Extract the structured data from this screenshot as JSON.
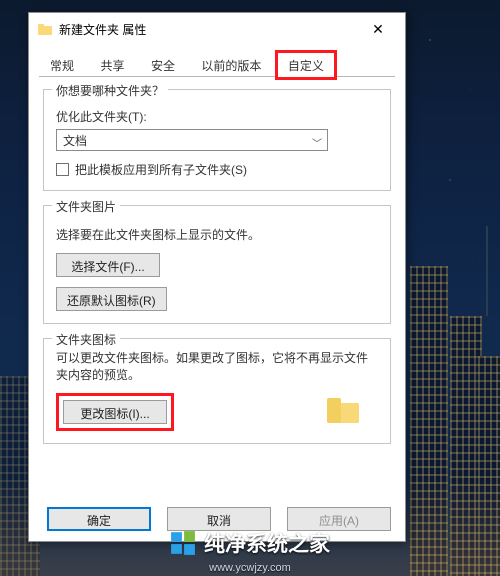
{
  "window": {
    "title": "新建文件夹 属性"
  },
  "tabs": [
    {
      "label": "常规",
      "active": false
    },
    {
      "label": "共享",
      "active": false
    },
    {
      "label": "安全",
      "active": false
    },
    {
      "label": "以前的版本",
      "active": false
    },
    {
      "label": "自定义",
      "active": true,
      "highlighted": true
    }
  ],
  "group1": {
    "title": "你想要哪种文件夹？",
    "optimize_label": "优化此文件夹(T):",
    "optimize_value": "文档",
    "apply_checkbox": "把此模板应用到所有子文件夹(S)"
  },
  "group2": {
    "title": "文件夹图片",
    "desc": "选择要在此文件夹图标上显示的文件。",
    "choose_file": "选择文件(F)...",
    "restore_default": "还原默认图标(R)"
  },
  "group3": {
    "title": "文件夹图标",
    "desc": "可以更改文件夹图标。如果更改了图标，它将不再显示文件夹内容的预览。",
    "change_icon": "更改图标(I)..."
  },
  "footer": {
    "ok": "确定",
    "cancel": "取消",
    "apply": "应用(A)"
  },
  "watermark": "纯净系统之家",
  "watermark_url": "www.ycwjzy.com"
}
